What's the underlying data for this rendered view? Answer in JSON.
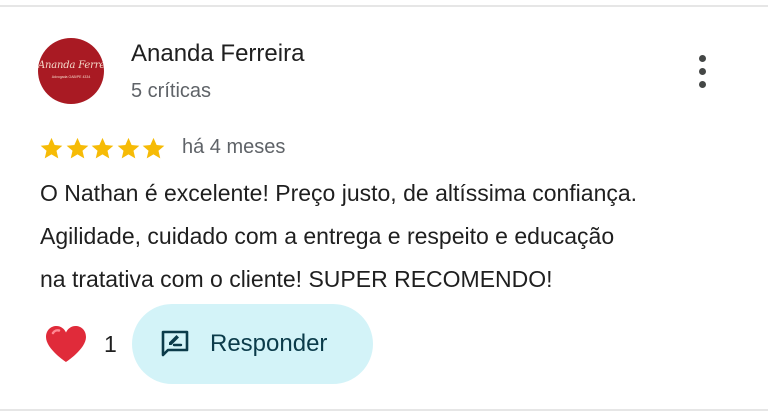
{
  "review": {
    "author_name": "Ananda Ferreira",
    "author_reviews": "5 críticas",
    "avatar_logo_text": "Ananda Ferreira",
    "avatar_logo_subtext": "Advogada OAB/PE 4334",
    "rating": 5,
    "rating_max": 5,
    "time_ago": "há 4 meses",
    "text_lines": [
      "O Nathan é excelente! Preço justo, de altíssima confiança.",
      "Agilidade, cuidado com a entrega e respeito e educação",
      "na tratativa com o cliente! SUPER RECOMENDO!"
    ],
    "likes": "1",
    "reply_label": "Responder"
  },
  "icons": {
    "more": "more-vert-icon",
    "star": "star-icon",
    "heart": "heart-icon",
    "reply": "rate-review-icon"
  },
  "colors": {
    "star": "#f6bb06",
    "heart": "#e02b3a",
    "reply_bg": "#d3f3f8",
    "avatar_bg": "#a91a23"
  }
}
